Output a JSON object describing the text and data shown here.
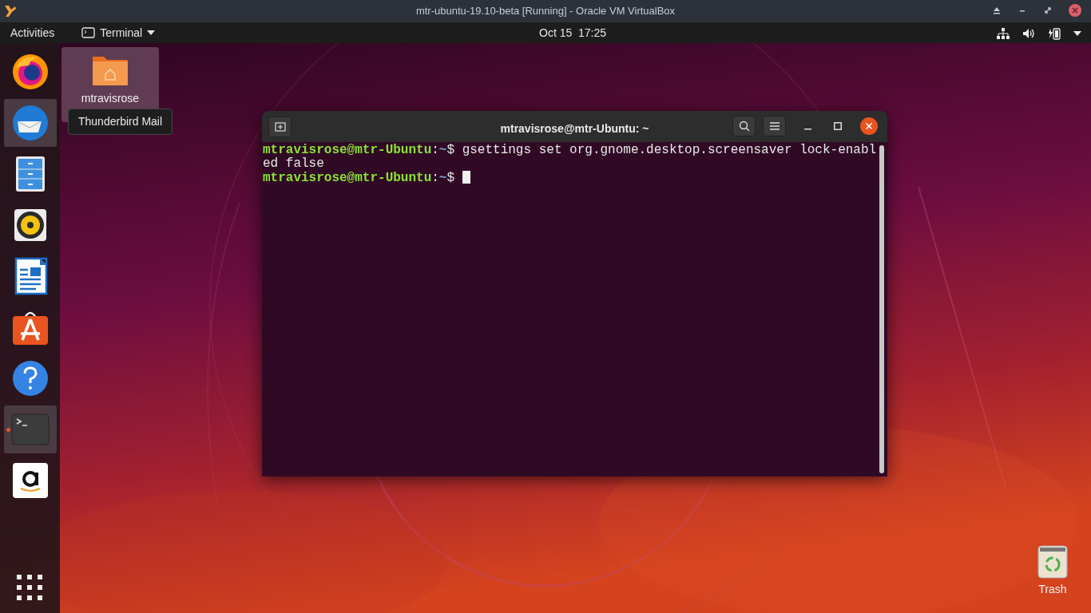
{
  "host_window": {
    "title": "mtr-ubuntu-19.10-beta [Running] - Oracle VM VirtualBox"
  },
  "top_bar": {
    "activities": "Activities",
    "app_menu": "Terminal",
    "clock": "Oct 15  17:25"
  },
  "dock": {
    "items": [
      {
        "kind": "firefox",
        "highlighted": false,
        "running": false
      },
      {
        "kind": "thunderbird",
        "highlighted": true,
        "running": false
      },
      {
        "kind": "files",
        "highlighted": false,
        "running": false
      },
      {
        "kind": "rhythmbox",
        "highlighted": false,
        "running": false
      },
      {
        "kind": "writer",
        "highlighted": false,
        "running": false
      },
      {
        "kind": "software",
        "highlighted": false,
        "running": false
      },
      {
        "kind": "help",
        "highlighted": false,
        "running": false
      },
      {
        "kind": "terminal",
        "highlighted": true,
        "running": true
      },
      {
        "kind": "amazon",
        "highlighted": false,
        "running": false
      }
    ],
    "tooltip": "Thunderbird Mail"
  },
  "desktop_icons": [
    {
      "kind": "home",
      "label": "mtravisrose",
      "selected": true
    },
    {
      "kind": "trash",
      "label": "Trash",
      "selected": false
    }
  ],
  "terminal": {
    "title": "mtravisrose@mtr-Ubuntu: ~",
    "lines": [
      {
        "user": "mtravisrose@mtr-Ubuntu",
        "separator": ":",
        "path": "~",
        "symbol": "$",
        "command": "gsettings set org.gnome.desktop.screensaver lock-enabled false"
      },
      {
        "user": "mtravisrose@mtr-Ubuntu",
        "separator": ":",
        "path": "~",
        "symbol": "$",
        "cursor": true
      }
    ]
  }
}
